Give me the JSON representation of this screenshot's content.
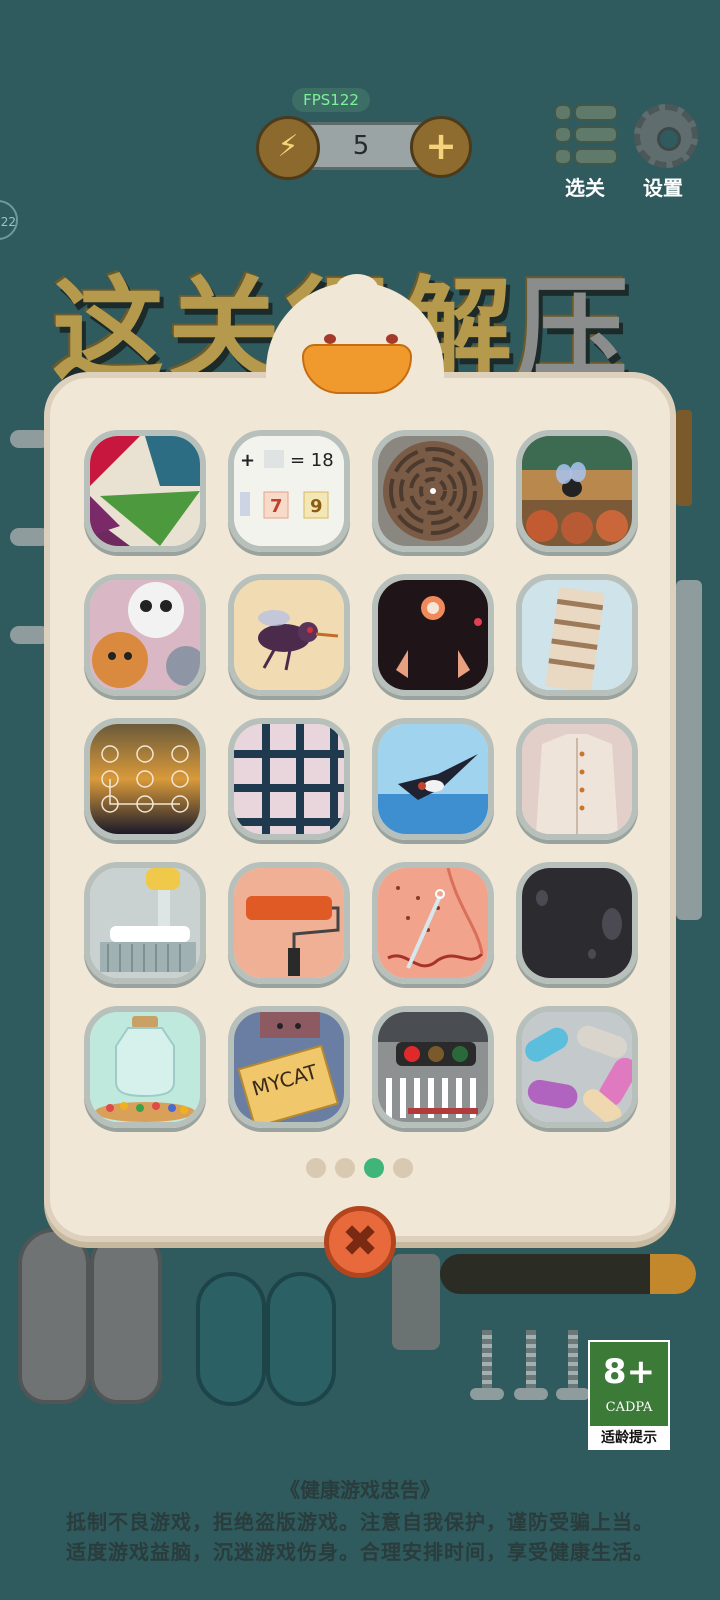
{
  "hud": {
    "fps_label": "FPS122",
    "energy_count": "5",
    "energy_icon": "lightning-icon",
    "add_icon": "plus-icon"
  },
  "nav": {
    "level_select_label": "选关",
    "settings_label": "设置"
  },
  "side_badge": "22",
  "title": {
    "part1": "这关很解",
    "part2": "压"
  },
  "level_picker": {
    "page_count": 4,
    "current_page": 3,
    "levels": [
      {
        "name": "geometric-shapes-level"
      },
      {
        "name": "math-equation-level",
        "text": "+ ▢ = 18",
        "digits": [
          "7",
          "9"
        ]
      },
      {
        "name": "maze-level"
      },
      {
        "name": "fly-on-shelf-level"
      },
      {
        "name": "animal-faces-level"
      },
      {
        "name": "mosquito-level"
      },
      {
        "name": "dark-creature-level"
      },
      {
        "name": "leaning-tower-level"
      },
      {
        "name": "pattern-lock-level"
      },
      {
        "name": "window-grid-level"
      },
      {
        "name": "swallow-level"
      },
      {
        "name": "shirt-level"
      },
      {
        "name": "toothbrush-level"
      },
      {
        "name": "paint-roller-level"
      },
      {
        "name": "nose-blackhead-level"
      },
      {
        "name": "dark-stain-level"
      },
      {
        "name": "candy-jar-level"
      },
      {
        "name": "mycat-box-level",
        "text": "MYCAT"
      },
      {
        "name": "traffic-light-level"
      },
      {
        "name": "slippers-level"
      }
    ],
    "close_icon": "close-icon"
  },
  "age_rating": {
    "age": "8+",
    "org": "CADPA",
    "tip": "适龄提示"
  },
  "health_advisory": {
    "title": "《健康游戏忠告》",
    "line1": "抵制不良游戏，拒绝盗版游戏。注意自我保护，谨防受骗上当。",
    "line2": "适度游戏益脑，沉迷游戏伤身。合理安排时间，享受健康生活。"
  },
  "colors": {
    "background": "#2f5a5e",
    "panel": "#f0e7d7",
    "active_dot": "#3fb57a",
    "close_button": "#e86a3c",
    "fps_text": "#7cf29a"
  }
}
